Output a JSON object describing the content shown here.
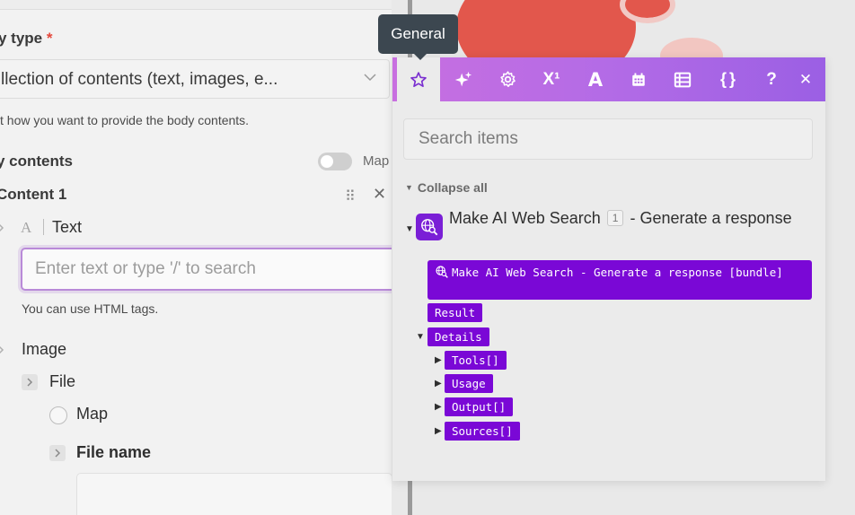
{
  "form": {
    "body_type_label": "y type",
    "body_type_required": "*",
    "body_type_value": "llection of contents (text, images, e...",
    "body_type_hint": "t how you want to provide the body contents.",
    "body_contents_label": "y contents",
    "map_toggle_label": "Map",
    "content_item_label": "Content 1",
    "text_field_label": "Text",
    "text_field_placeholder": "Enter text or type '/' to search",
    "text_field_hint": "You can use HTML tags.",
    "image_label": "Image",
    "file_label": "File",
    "map_option_label": "Map",
    "file_name_label": "File name"
  },
  "tooltip": {
    "text": "General"
  },
  "popover": {
    "toolbar_icons": [
      "star-icon",
      "sparkle-icon",
      "gear-icon",
      "superscript-icon",
      "text-icon",
      "calendar-icon",
      "table-icon",
      "braces-icon",
      "help-icon",
      "close-icon"
    ],
    "toolbar_glyphs": {
      "superscript": "X¹",
      "text": "A",
      "braces": "{ }",
      "help": "?",
      "close": "✕"
    },
    "search_placeholder": "Search items",
    "collapse_all": "Collapse all",
    "module": {
      "name": "Make AI Web Search",
      "badge": "1",
      "action": "- Generate a response"
    },
    "bundle_label": "Make AI Web Search - Generate a response [bundle]",
    "items": {
      "result": "Result",
      "details": "Details",
      "tools": "Tools[]",
      "usage": "Usage",
      "output": "Output[]",
      "sources": "Sources[]"
    }
  },
  "colors": {
    "accent_purple": "#7a08d6",
    "toolbar_gradient_start": "#c86fe0",
    "toolbar_gradient_end": "#9b5fe4",
    "required_red": "#e4473b",
    "module_red": "#e2574c"
  }
}
